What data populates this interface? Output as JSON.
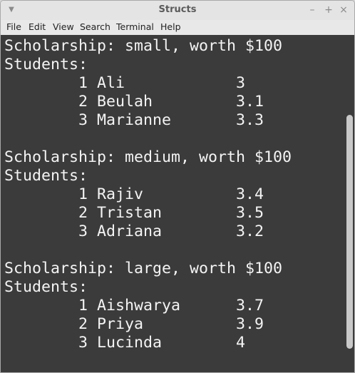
{
  "window": {
    "title": "Structs"
  },
  "titlebar_buttons": {
    "menu": "▼",
    "minimize": "–",
    "maximize": "+",
    "close": "×"
  },
  "menu": [
    "File",
    "Edit",
    "View",
    "Search",
    "Terminal",
    "Help"
  ],
  "terminal": {
    "lines": [
      "Scholarship: small, worth $100",
      "Students:",
      "        1 Ali            3",
      "        2 Beulah         3.1",
      "        3 Marianne       3.3",
      "",
      "Scholarship: medium, worth $100",
      "Students:",
      "        1 Rajiv          3.4",
      "        2 Tristan        3.5",
      "        3 Adriana        3.2",
      "",
      "Scholarship: large, worth $100",
      "Students:",
      "        1 Aishwarya      3.7",
      "        2 Priya          3.9",
      "        3 Lucinda        4"
    ]
  },
  "colors": {
    "terminal_bg": "#3b3b3b",
    "terminal_fg": "#f4f4f4"
  }
}
